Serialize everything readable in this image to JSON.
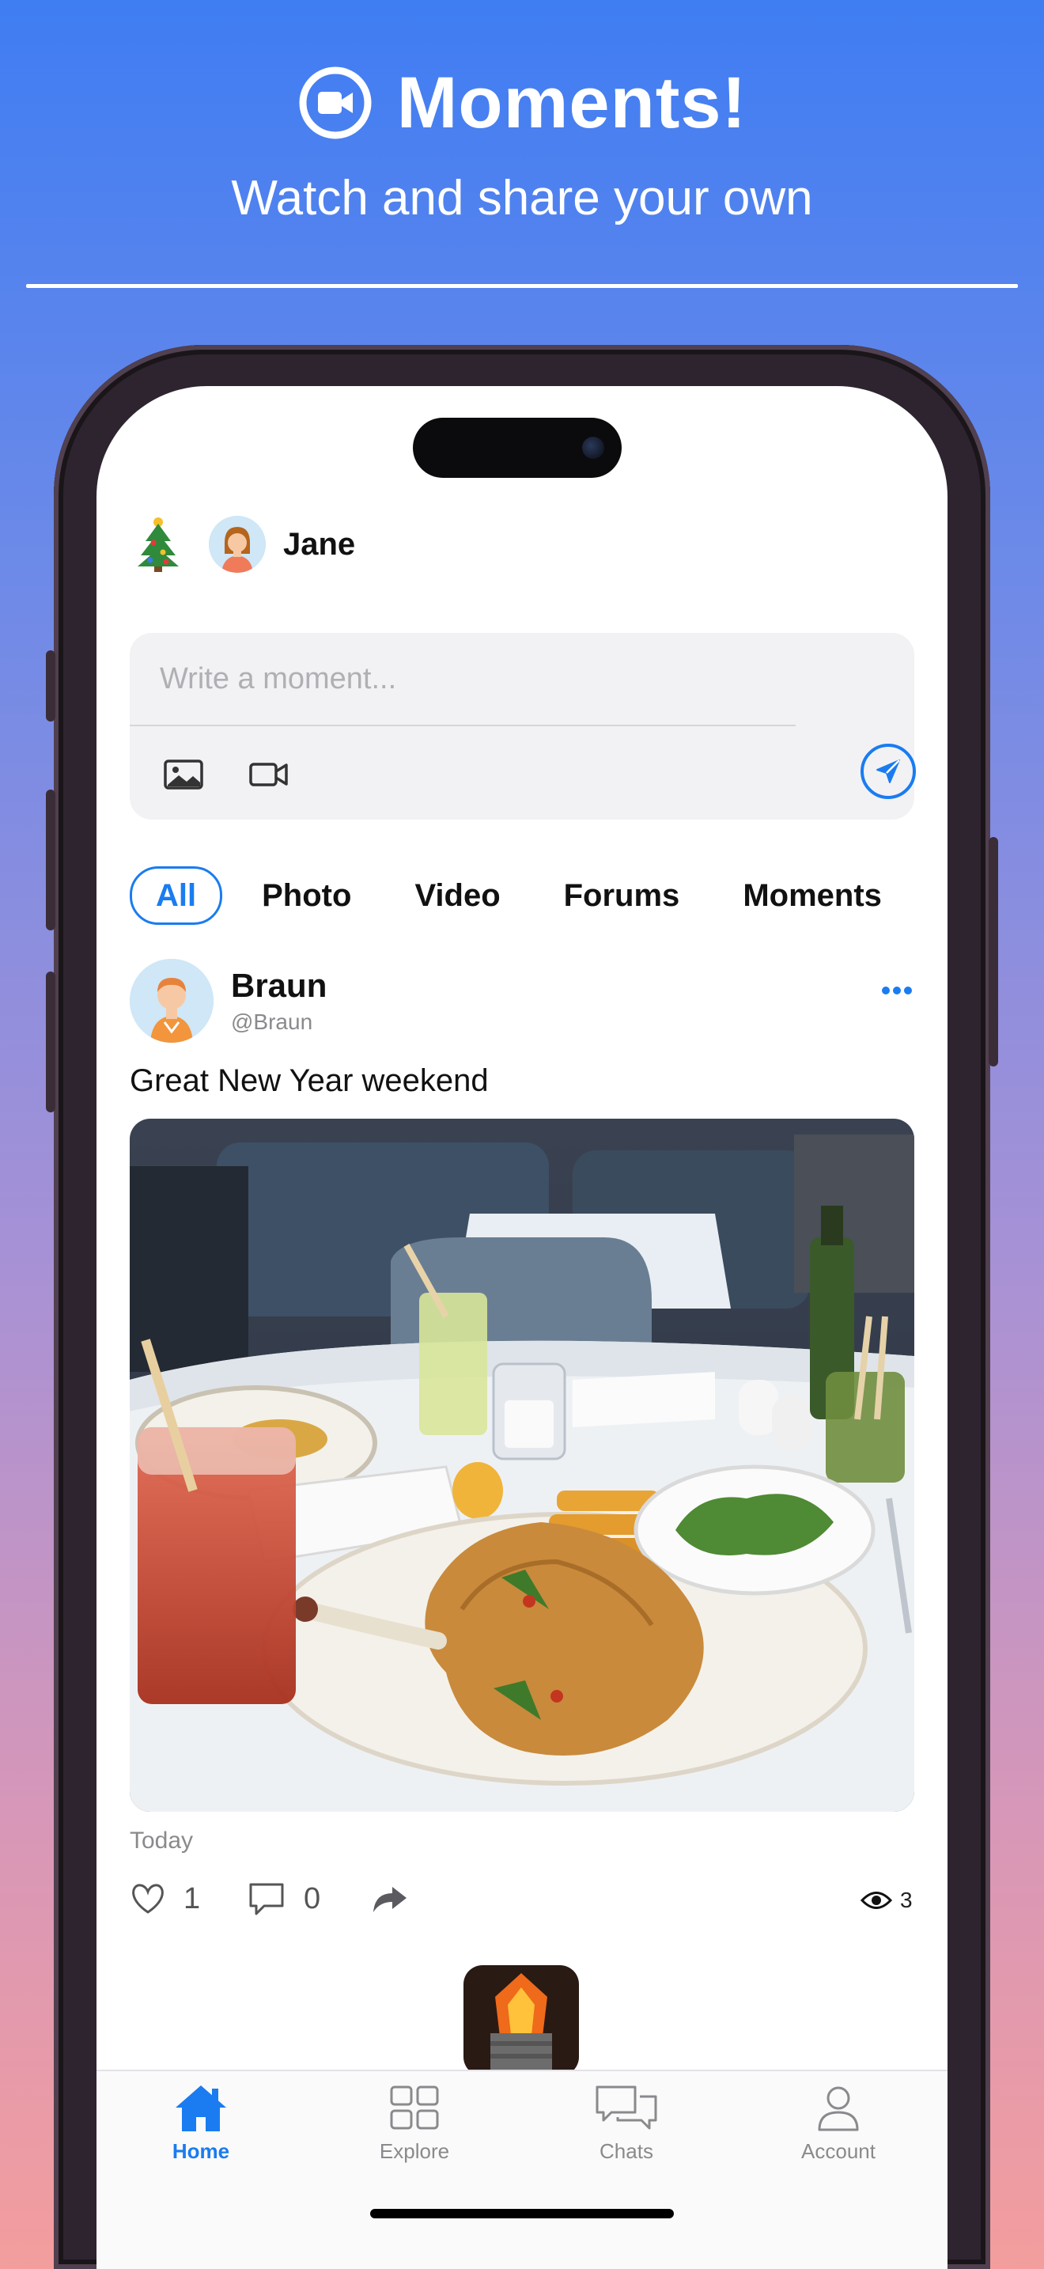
{
  "banner": {
    "title": "Moments!",
    "subtitle": "Watch and share your own",
    "icon": "video-camera-icon"
  },
  "header": {
    "user_name": "Jane",
    "decoration_icon": "christmas-tree-icon"
  },
  "composer": {
    "placeholder": "Write a moment...",
    "tools": [
      "photo-icon",
      "video-icon"
    ],
    "send_icon": "send-icon"
  },
  "tabs": [
    {
      "label": "All",
      "active": true
    },
    {
      "label": "Photo",
      "active": false
    },
    {
      "label": "Video",
      "active": false
    },
    {
      "label": "Forums",
      "active": false
    },
    {
      "label": "Moments",
      "active": false
    }
  ],
  "post": {
    "author_name": "Braun",
    "author_handle": "@Braun",
    "text": "Great New Year weekend",
    "date": "Today",
    "likes": "1",
    "comments": "0",
    "views": "3"
  },
  "tabbar": [
    {
      "label": "Home",
      "icon": "home-icon",
      "active": true
    },
    {
      "label": "Explore",
      "icon": "grid-icon",
      "active": false
    },
    {
      "label": "Chats",
      "icon": "chat-bubbles-icon",
      "active": false
    },
    {
      "label": "Account",
      "icon": "person-icon",
      "active": false
    }
  ],
  "colors": {
    "accent": "#1a7cf0",
    "gradient_top": "#3f7df3",
    "gradient_bottom": "#f39d9d"
  }
}
